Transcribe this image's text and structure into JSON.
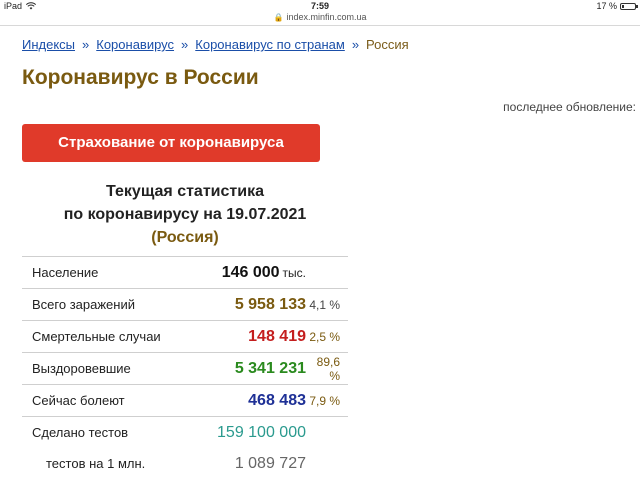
{
  "status_bar": {
    "device": "iPad",
    "time": "7:59",
    "battery": "17 %",
    "battery_level": 0.17
  },
  "url_bar": {
    "url": "index.minfin.com.ua"
  },
  "breadcrumb": {
    "items": [
      "Индексы",
      "Коронавирус",
      "Коронавирус по странам"
    ],
    "separator": "»",
    "current": "Россия"
  },
  "page": {
    "title": "Коронавирус в России",
    "last_update_label": "последнее обновление:",
    "cta_label": "Страхование от коронавируса"
  },
  "stats": {
    "heading_line1": "Текущая статистика",
    "heading_line2": "по коронавирусу на 19.07.2021",
    "country": "(Россия)",
    "rows": [
      {
        "label": "Население",
        "value": "146 000",
        "unit": "тыс.",
        "pct": ""
      },
      {
        "label": "Всего заражений",
        "value": "5 958 133",
        "pct": "4,1 %"
      },
      {
        "label": "Смертельные случаи",
        "value": "148 419",
        "pct": "2,5 %"
      },
      {
        "label": "Выздоровевшие",
        "value": "5 341 231",
        "pct": "89,6 %"
      },
      {
        "label": "Сейчас болеют",
        "value": "468 483",
        "pct": "7,9 %"
      },
      {
        "label": "Сделано тестов",
        "value": "159 100 000",
        "pct": ""
      },
      {
        "label": "тестов на 1 млн.",
        "value": "1 089 727",
        "pct": ""
      }
    ]
  },
  "colors": {
    "accent_title": "#7a5a10",
    "link": "#1a4ea8",
    "cta": "#e03a2a",
    "deaths": "#c41e1e",
    "recovered": "#2a8a1e",
    "active": "#1e3096",
    "tests": "#2a9a8e"
  }
}
